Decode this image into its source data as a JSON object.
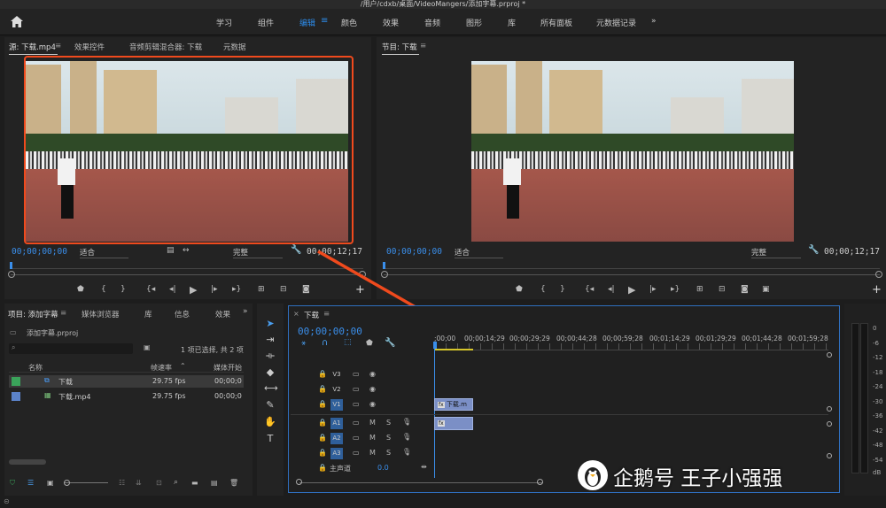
{
  "titlebar": {
    "path": "/用户/cdxb/桌面/VideoMangers/添加字幕.prproj *"
  },
  "workspaces": [
    {
      "label": "学习"
    },
    {
      "label": "组件"
    },
    {
      "label": "编辑"
    },
    {
      "label": "颜色"
    },
    {
      "label": "效果"
    },
    {
      "label": "音频"
    },
    {
      "label": "图形"
    },
    {
      "label": "库"
    },
    {
      "label": "所有面板"
    },
    {
      "label": "元数据记录"
    }
  ],
  "source_panel": {
    "tabs": [
      "源: 下载.mp4",
      "效果控件",
      "音频剪辑混合器: 下载",
      "元数据"
    ],
    "timecode_in": "00;00;00;00",
    "fit": "适合",
    "quality": "完整",
    "timecode_dur": "00;00;12;17"
  },
  "program_panel": {
    "tab": "节目: 下载",
    "timecode_in": "00;00;00;00",
    "fit": "适合",
    "quality": "完整",
    "timecode_dur": "00;00;12;17"
  },
  "project_panel": {
    "tabs": [
      "项目: 添加字幕",
      "媒体浏览器",
      "库",
      "信息",
      "效果"
    ],
    "project_file": "添加字幕.prproj",
    "selection_info": "1 项已选择, 共 2 项",
    "columns": {
      "name": "名称",
      "fps": "帧速率",
      "start": "媒体开始"
    },
    "items": [
      {
        "name": "下载",
        "fps": "29.75 fps",
        "start": "00;00;0",
        "color": "#3aa35a"
      },
      {
        "name": "下载.mp4",
        "fps": "29.75 fps",
        "start": "00;00;0",
        "color": "#5b82c9"
      }
    ]
  },
  "timeline": {
    "tab": "下载",
    "timecode": "00;00;00;00",
    "ticks": [
      ";00;00",
      "00;00;14;29",
      "00;00;29;29",
      "00;00;44;28",
      "00;00;59;28",
      "00;01;14;29",
      "00;01;29;29",
      "00;01;44;28",
      "00;01;59;28"
    ],
    "video_tracks": [
      "V3",
      "V2",
      "V1"
    ],
    "audio_tracks": [
      "A1",
      "A2",
      "A3"
    ],
    "master_label": "主声道",
    "master_value": "0.0",
    "mute_label": "M",
    "solo_label": "S",
    "video_clip_label": "下载.m"
  },
  "meter": {
    "labels": [
      "0",
      "-6",
      "-12",
      "-18",
      "-24",
      "-30",
      "-36",
      "-42",
      "-48",
      "-54",
      "dB"
    ]
  },
  "watermark": {
    "text": "企鹅号 王子小强强"
  }
}
